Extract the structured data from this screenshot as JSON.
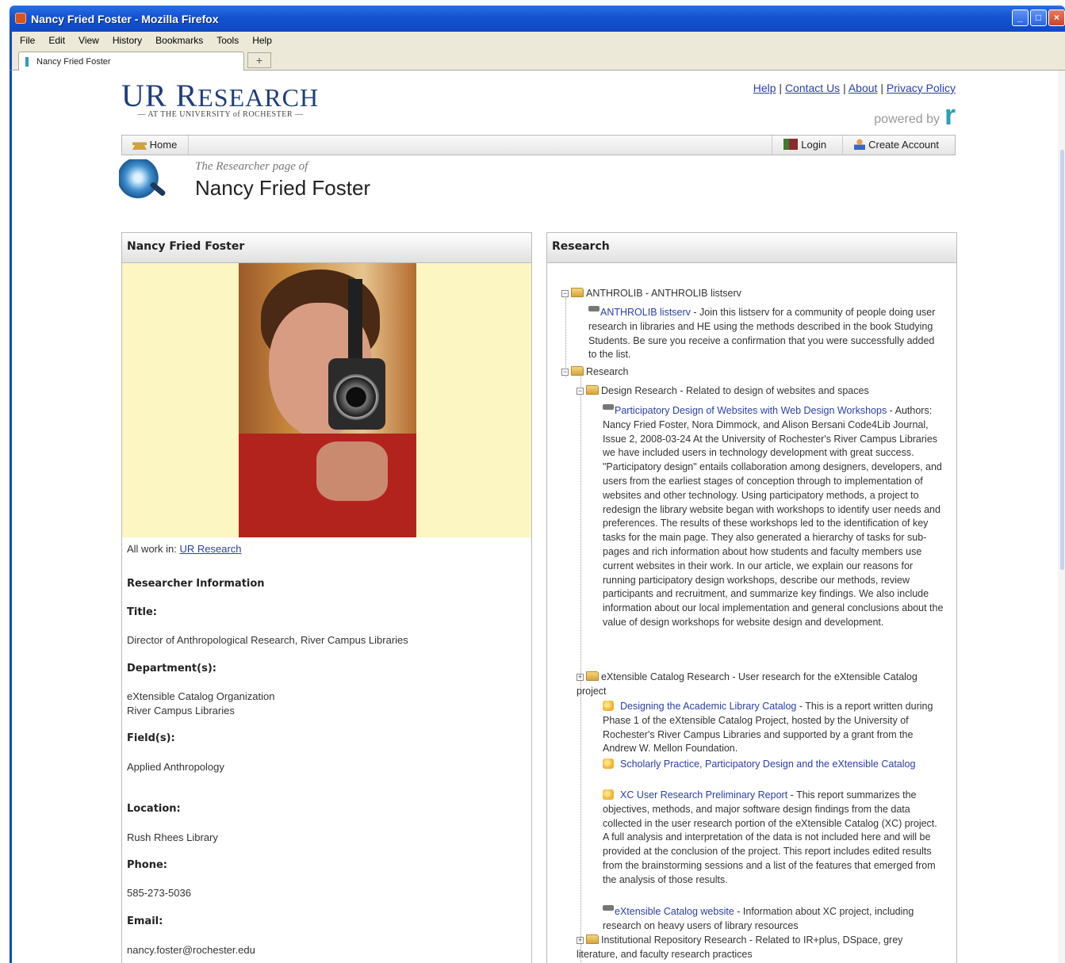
{
  "window": {
    "title": "Nancy Fried Foster - Mozilla Firefox",
    "menus": [
      "File",
      "Edit",
      "View",
      "History",
      "Bookmarks",
      "Tools",
      "Help"
    ],
    "tab_title": "Nancy Fried Foster",
    "new_tab": "+"
  },
  "header": {
    "logo_text": "UR R",
    "logo_smallcaps": "ESEARCH",
    "logo_sub": "— AT THE UNIVERSITY of ROCHESTER —",
    "links": [
      "Help",
      "Contact Us",
      "About",
      "Privacy Policy"
    ],
    "powered_by": "powered by",
    "powered_logo": "r"
  },
  "nav": {
    "home": "Home",
    "login": "Login",
    "create_account": "Create Account"
  },
  "researcher": {
    "subtitle": "The Researcher page of",
    "name": "Nancy Fried Foster"
  },
  "left_panel": {
    "heading": "Nancy Fried Foster",
    "all_work_label": "All work in:",
    "all_work_link": "UR Research",
    "info_heading": "Researcher Information",
    "title_label": "Title:",
    "title_value": "Director of Anthropological Research, River Campus Libraries",
    "department_label": "Department(s):",
    "department_1": "eXtensible Catalog Organization",
    "department_2": "River Campus Libraries",
    "field_label": "Field(s):",
    "field_value": "Applied Anthropology",
    "location_label": "Location:",
    "location_value": "Rush Rhees Library",
    "phone_label": "Phone:",
    "phone_value": "585-273-5036",
    "email_label": "Email:",
    "email_value": "nancy.foster@rochester.edu"
  },
  "right_panel": {
    "heading": "Research",
    "anthrolib_folder": "ANTHROLIB - ANTHROLIB listserv",
    "anthrolib_link": "ANTHROLIB listserv",
    "anthrolib_desc": " - Join this listserv for a community of people doing user research in libraries and HE using the methods described in the book Studying Students. Be sure you receive a confirmation that you were successfully added to the list.",
    "research_folder": "Research",
    "design_folder": "Design Research - Related to design of websites and spaces",
    "pd_link": "Participatory Design of Websites with Web Design Workshops",
    "pd_desc": " - Authors: Nancy Fried Foster, Nora Dimmock, and Alison Bersani Code4Lib Journal, Issue 2, 2008-03-24 At the University of Rochester's River Campus Libraries we have included users in technology development with great success. \"Participatory design\" entails collaboration among designers, developers, and users from the earliest stages of conception through to implementation of websites and other technology. Using participatory methods, a project to redesign the library website began with workshops to identify user needs and preferences. The results of these workshops led to the identification of key tasks for the main page. They also generated a hierarchy of tasks for sub-pages and rich information about how students and faculty members use current websites in their work. In our article, we explain our reasons for running participatory design workshops, describe our methods, review participants and recruitment, and summarize key findings. We also include information about our local implementation and general conclusions about the value of design workshops for website design and development.",
    "xc_folder": "eXtensible Catalog Research - User research for the eXtensible Catalog project",
    "dalc_link": "Designing the Academic Library Catalog",
    "dalc_desc": " - This is a report written during Phase 1 of the eXtensible Catalog Project, hosted by the University of Rochester's River Campus Libraries and supported by a grant from the Andrew W. Mellon Foundation.",
    "sp_link": "Scholarly Practice, Participatory Design and the eXtensible Catalog",
    "xcur_link": "XC User Research Preliminary Report",
    "xcur_desc": " - This report summarizes the objectives, methods, and major software design findings from the data collected in the user research portion of the eXtensible Catalog (XC) project. A full analysis and interpretation of the data is not included here and will be provided at the conclusion of the project. This report includes edited results from the brainstorming sessions and a list of the features that emerged from the analysis of those results.",
    "xcweb_link": "eXtensible Catalog website",
    "xcweb_desc": " - Information about XC project, including research on heavy users of library resources",
    "ir_folder": "Institutional Repository Research - Related to IR+plus, DSpace, grey literature, and faculty research practices"
  },
  "colors": {
    "link": "#2b3fa8",
    "title_bar": "#1452d0",
    "photo_background": "#fbf6c2"
  }
}
